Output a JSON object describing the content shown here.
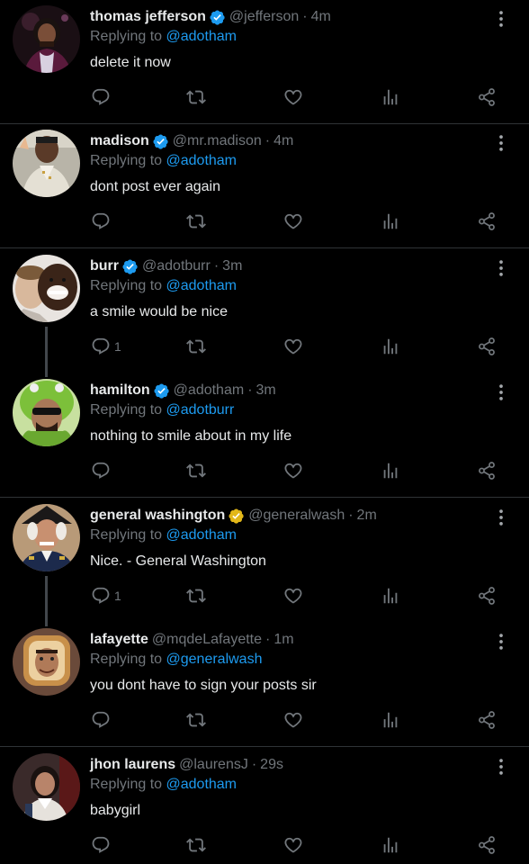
{
  "colors": {
    "background": "#000000",
    "text": "#e7e9ea",
    "muted": "#71767b",
    "link": "#1d9bf0",
    "verified_blue": "#1d9bf0",
    "verified_gold": "#e2b719",
    "divider": "#2f3336"
  },
  "tweets": [
    {
      "name": "thomas jefferson",
      "verified": "blue",
      "handle": "@jefferson",
      "time": "4m",
      "replying_prefix": "Replying to",
      "replying_to": "@adotham",
      "text": "delete it now",
      "reply_count": "",
      "avatar": "thomas-jefferson-avatar"
    },
    {
      "name": "madison",
      "verified": "blue",
      "handle": "@mr.madison",
      "time": "4m",
      "replying_prefix": "Replying to",
      "replying_to": "@adotham",
      "text": "dont post ever again",
      "reply_count": "",
      "avatar": "madison-avatar"
    },
    {
      "name": "burr",
      "verified": "blue",
      "handle": "@adotburr",
      "time": "3m",
      "replying_prefix": "Replying to",
      "replying_to": "@adotham",
      "text": "a smile would be nice",
      "reply_count": "1",
      "avatar": "burr-avatar"
    },
    {
      "name": "hamilton",
      "verified": "blue",
      "handle": "@adotham",
      "time": "3m",
      "replying_prefix": "Replying to",
      "replying_to": "@adotburr",
      "text": "nothing to smile about in my life",
      "reply_count": "",
      "avatar": "hamilton-avatar"
    },
    {
      "name": "general washington",
      "verified": "gold",
      "handle": "@generalwash",
      "time": "2m",
      "replying_prefix": "Replying to",
      "replying_to": "@adotham",
      "text": "Nice. - General Washington",
      "reply_count": "1",
      "avatar": "general-washington-avatar"
    },
    {
      "name": "lafayette",
      "verified": "none",
      "handle": "@mqdeLafayette",
      "time": "1m",
      "replying_prefix": "Replying to",
      "replying_to": "@generalwash",
      "text": "you dont have to sign your posts sir",
      "reply_count": "",
      "avatar": "lafayette-avatar"
    },
    {
      "name": "jhon laurens",
      "verified": "none",
      "handle": "@laurensJ",
      "time": "29s",
      "replying_prefix": "Replying to",
      "replying_to": "@adotham",
      "text": "babygirl",
      "reply_count": "",
      "avatar": "jhon-laurens-avatar"
    }
  ],
  "icons": {
    "reply": "reply-icon",
    "retweet": "retweet-icon",
    "like": "heart-icon",
    "views": "views-icon",
    "share": "share-icon",
    "more": "more-options-icon",
    "verified": "verified-badge-icon"
  }
}
